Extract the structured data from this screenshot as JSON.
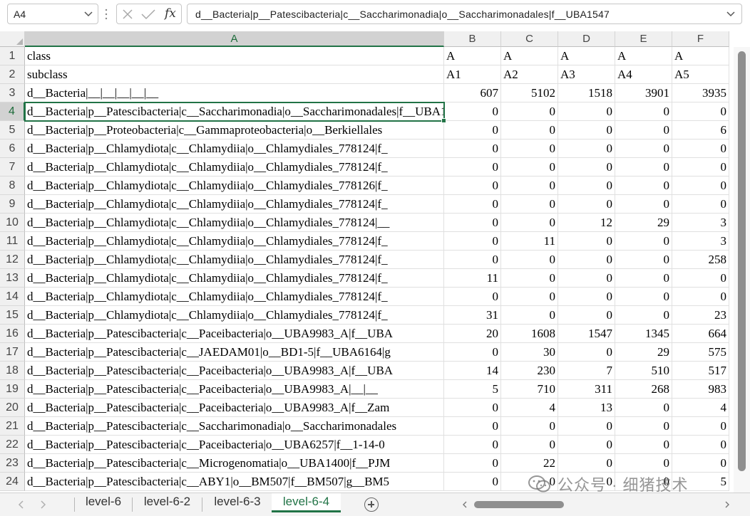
{
  "formula_bar": {
    "name_box": "A4",
    "fx_label": "fx",
    "formula": "d__Bacteria|p__Patescibacteria|c__Saccharimonadia|o__Saccharimonadales|f__UBA1547"
  },
  "grid": {
    "active_cell": "A4",
    "columns": [
      "A",
      "B",
      "C",
      "D",
      "E",
      "F"
    ],
    "rows": [
      {
        "num": "1",
        "cells": [
          "class",
          "A",
          "A",
          "A",
          "A",
          "A"
        ]
      },
      {
        "num": "2",
        "cells": [
          "subclass",
          "A1",
          "A2",
          "A3",
          "A4",
          "A5"
        ]
      },
      {
        "num": "3",
        "cells": [
          "d__Bacteria|__|__|__|__|__",
          "607",
          "5102",
          "1518",
          "3901",
          "3935"
        ]
      },
      {
        "num": "4",
        "cells": [
          "d__Bacteria|p__Patescibacteria|c__Saccharimonadia|o__Saccharimonadales|f__UBA1547",
          "0",
          "0",
          "0",
          "0",
          "0"
        ]
      },
      {
        "num": "5",
        "cells": [
          "d__Bacteria|p__Proteobacteria|c__Gammaproteobacteria|o__Berkiellales",
          "0",
          "0",
          "0",
          "0",
          "6"
        ]
      },
      {
        "num": "6",
        "cells": [
          "d__Bacteria|p__Chlamydiota|c__Chlamydiia|o__Chlamydiales_778124|f_",
          "0",
          "0",
          "0",
          "0",
          "0"
        ]
      },
      {
        "num": "7",
        "cells": [
          "d__Bacteria|p__Chlamydiota|c__Chlamydiia|o__Chlamydiales_778124|f_",
          "0",
          "0",
          "0",
          "0",
          "0"
        ]
      },
      {
        "num": "8",
        "cells": [
          "d__Bacteria|p__Chlamydiota|c__Chlamydiia|o__Chlamydiales_778126|f_",
          "0",
          "0",
          "0",
          "0",
          "0"
        ]
      },
      {
        "num": "9",
        "cells": [
          "d__Bacteria|p__Chlamydiota|c__Chlamydiia|o__Chlamydiales_778124|f_",
          "0",
          "0",
          "0",
          "0",
          "0"
        ]
      },
      {
        "num": "10",
        "cells": [
          "d__Bacteria|p__Chlamydiota|c__Chlamydiia|o__Chlamydiales_778124|__",
          "0",
          "0",
          "12",
          "29",
          "3"
        ]
      },
      {
        "num": "11",
        "cells": [
          "d__Bacteria|p__Chlamydiota|c__Chlamydiia|o__Chlamydiales_778124|f_",
          "0",
          "11",
          "0",
          "0",
          "3"
        ]
      },
      {
        "num": "12",
        "cells": [
          "d__Bacteria|p__Chlamydiota|c__Chlamydiia|o__Chlamydiales_778124|f_",
          "0",
          "0",
          "0",
          "0",
          "258"
        ]
      },
      {
        "num": "13",
        "cells": [
          "d__Bacteria|p__Chlamydiota|c__Chlamydiia|o__Chlamydiales_778124|f_",
          "11",
          "0",
          "0",
          "0",
          "0"
        ]
      },
      {
        "num": "14",
        "cells": [
          "d__Bacteria|p__Chlamydiota|c__Chlamydiia|o__Chlamydiales_778124|f_",
          "0",
          "0",
          "0",
          "0",
          "0"
        ]
      },
      {
        "num": "15",
        "cells": [
          "d__Bacteria|p__Chlamydiota|c__Chlamydiia|o__Chlamydiales_778124|f_",
          "31",
          "0",
          "0",
          "0",
          "23"
        ]
      },
      {
        "num": "16",
        "cells": [
          "d__Bacteria|p__Patescibacteria|c__Paceibacteria|o__UBA9983_A|f__UBA",
          "20",
          "1608",
          "1547",
          "1345",
          "664"
        ]
      },
      {
        "num": "17",
        "cells": [
          "d__Bacteria|p__Patescibacteria|c__JAEDAM01|o__BD1-5|f__UBA6164|g",
          "0",
          "30",
          "0",
          "29",
          "575"
        ]
      },
      {
        "num": "18",
        "cells": [
          "d__Bacteria|p__Patescibacteria|c__Paceibacteria|o__UBA9983_A|f__UBA",
          "14",
          "230",
          "7",
          "510",
          "517"
        ]
      },
      {
        "num": "19",
        "cells": [
          "d__Bacteria|p__Patescibacteria|c__Paceibacteria|o__UBA9983_A|__|__",
          "5",
          "710",
          "311",
          "268",
          "983"
        ]
      },
      {
        "num": "20",
        "cells": [
          "d__Bacteria|p__Patescibacteria|c__Paceibacteria|o__UBA9983_A|f__Zam",
          "0",
          "4",
          "13",
          "0",
          "4"
        ]
      },
      {
        "num": "21",
        "cells": [
          "d__Bacteria|p__Patescibacteria|c__Saccharimonadia|o__Saccharimonadales",
          "0",
          "0",
          "0",
          "0",
          "0"
        ]
      },
      {
        "num": "22",
        "cells": [
          "d__Bacteria|p__Patescibacteria|c__Paceibacteria|o__UBA6257|f__1-14-0",
          "0",
          "0",
          "0",
          "0",
          "0"
        ]
      },
      {
        "num": "23",
        "cells": [
          "d__Bacteria|p__Patescibacteria|c__Microgenomatia|o__UBA1400|f__PJM",
          "0",
          "22",
          "0",
          "0",
          "0"
        ]
      },
      {
        "num": "24",
        "cells": [
          "d__Bacteria|p__Patescibacteria|c__ABY1|o__BM507|f__BM507|g__BM5",
          "0",
          "0",
          "0",
          "0",
          "5"
        ]
      }
    ]
  },
  "sheet_tabs": [
    {
      "label": "level-6",
      "active": false
    },
    {
      "label": "level-6-2",
      "active": false
    },
    {
      "label": "level-6-3",
      "active": false
    },
    {
      "label": "level-6-4",
      "active": true
    }
  ],
  "watermark": {
    "text": "公众号 · 细猪技术"
  },
  "icons": {
    "name_box_dropdown": "chevron-down-icon",
    "cancel": "close-icon",
    "enter": "check-icon",
    "insert_function": "fx-icon",
    "formula_expand": "chevron-down-icon",
    "prev_sheet": "chevron-left-icon",
    "next_sheet": "chevron-right-icon",
    "add_sheet": "plus-circle-icon",
    "watermark_logo": "wechat-icon"
  },
  "colors": {
    "accent": "#217346",
    "header_bg": "#f0f0f0",
    "active_header_bg": "#d2d2d2"
  }
}
